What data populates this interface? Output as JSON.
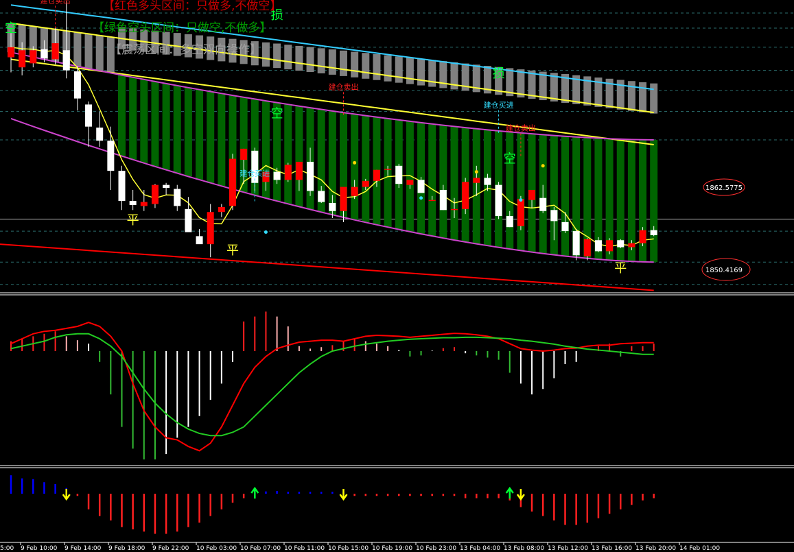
{
  "legend": {
    "red_zone": "【红色多头区间：只做多,不做空】",
    "green_zone": "【绿色空头区间：只做空,不做多】",
    "range_zone": "【震荡区间：多空双向操作】"
  },
  "price_labels": {
    "upper": "1862.5775",
    "lower": "1850.4169"
  },
  "colors": {
    "background": "#000000",
    "bull_candle": "#ff0000",
    "bear_candle": "#ffffff",
    "bear_zone_bar": "#006400",
    "range_zone_bar": "#808080",
    "envelope_line": "#cc44cc",
    "cyan_line": "#33ccff",
    "yellow_line": "#ffff33",
    "slow_red_line": "#ff0000",
    "signal_red": "#ff2020",
    "signal_cyan": "#33ddff",
    "hist_red": "#ff2020",
    "hist_pink": "#ffb0b0",
    "hist_green": "#33bb33",
    "hist_white": "#ffffff",
    "osc_red": "#ff0000",
    "osc_green": "#22cc22",
    "bar_blue": "#0000ff",
    "arrow_yellow": "#ffff00",
    "arrow_green": "#00ff33"
  },
  "chart_data": [
    {
      "type": "candlestick",
      "title": "",
      "x_labels": [
        "9 Feb 10:00",
        "9 Feb 14:00",
        "9 Feb 18:00",
        "9 Feb 22:00",
        "10 Feb 03:00",
        "10 Feb 07:00",
        "10 Feb 11:00",
        "10 Feb 15:00",
        "10 Feb 19:00",
        "10 Feb 23:00",
        "13 Feb 04:00",
        "13 Feb 08:00",
        "13 Feb 12:00",
        "13 Feb 16:00",
        "13 Feb 20:00",
        "14 Feb 01:00"
      ],
      "x_label_partial_left": "5:00",
      "y_range": [
        1847.5,
        1876.5
      ],
      "candles": [
        {
          "o": 1870.8,
          "h": 1873.2,
          "l": 1869.3,
          "c": 1871.8
        },
        {
          "o": 1869.8,
          "h": 1872.3,
          "l": 1869.0,
          "c": 1871.5
        },
        {
          "o": 1870.2,
          "h": 1871.9,
          "l": 1869.8,
          "c": 1871.5
        },
        {
          "o": 1871.6,
          "h": 1872.5,
          "l": 1870.3,
          "c": 1870.7
        },
        {
          "o": 1870.6,
          "h": 1873.7,
          "l": 1870.1,
          "c": 1872.2
        },
        {
          "o": 1871.5,
          "h": 1876.4,
          "l": 1868.7,
          "c": 1869.5
        },
        {
          "o": 1869.4,
          "h": 1869.9,
          "l": 1865.5,
          "c": 1866.7
        },
        {
          "o": 1866.1,
          "h": 1866.4,
          "l": 1861.9,
          "c": 1863.9
        },
        {
          "o": 1863.8,
          "h": 1865.4,
          "l": 1861.9,
          "c": 1862.5
        },
        {
          "o": 1862.5,
          "h": 1863.9,
          "l": 1857.6,
          "c": 1859.5
        },
        {
          "o": 1859.5,
          "h": 1860.0,
          "l": 1855.6,
          "c": 1856.5
        },
        {
          "o": 1856.5,
          "h": 1857.6,
          "l": 1855.6,
          "c": 1856.1
        },
        {
          "o": 1856.0,
          "h": 1857.6,
          "l": 1855.5,
          "c": 1856.4
        },
        {
          "o": 1856.2,
          "h": 1858.2,
          "l": 1855.8,
          "c": 1858.1
        },
        {
          "o": 1858.1,
          "h": 1858.3,
          "l": 1857.1,
          "c": 1857.8
        },
        {
          "o": 1857.7,
          "h": 1858.1,
          "l": 1855.5,
          "c": 1856.0
        },
        {
          "o": 1855.7,
          "h": 1856.9,
          "l": 1853.7,
          "c": 1853.4
        },
        {
          "o": 1853.0,
          "h": 1853.7,
          "l": 1852.8,
          "c": 1852.2
        },
        {
          "o": 1852.2,
          "h": 1856.2,
          "l": 1850.9,
          "c": 1855.4
        },
        {
          "o": 1855.4,
          "h": 1856.2,
          "l": 1854.9,
          "c": 1855.9
        },
        {
          "o": 1856.0,
          "h": 1861.2,
          "l": 1855.6,
          "c": 1860.7
        },
        {
          "o": 1860.6,
          "h": 1861.7,
          "l": 1858.2,
          "c": 1861.7
        },
        {
          "o": 1861.5,
          "h": 1861.8,
          "l": 1857.5,
          "c": 1858.3
        },
        {
          "o": 1858.4,
          "h": 1859.0,
          "l": 1857.5,
          "c": 1859.4
        },
        {
          "o": 1859.4,
          "h": 1859.8,
          "l": 1858.2,
          "c": 1858.6
        },
        {
          "o": 1858.6,
          "h": 1860.3,
          "l": 1858.4,
          "c": 1860.1
        },
        {
          "o": 1858.6,
          "h": 1860.2,
          "l": 1857.5,
          "c": 1860.4
        },
        {
          "o": 1860.4,
          "h": 1861.8,
          "l": 1857.0,
          "c": 1857.5
        },
        {
          "o": 1857.5,
          "h": 1858.0,
          "l": 1856.3,
          "c": 1856.4
        },
        {
          "o": 1856.3,
          "h": 1857.1,
          "l": 1854.8,
          "c": 1855.5
        },
        {
          "o": 1855.5,
          "h": 1856.6,
          "l": 1854.4,
          "c": 1857.9
        },
        {
          "o": 1857.0,
          "h": 1858.6,
          "l": 1856.7,
          "c": 1857.9
        },
        {
          "o": 1857.9,
          "h": 1858.7,
          "l": 1857.6,
          "c": 1858.5
        },
        {
          "o": 1858.5,
          "h": 1859.6,
          "l": 1857.9,
          "c": 1859.6
        },
        {
          "o": 1859.6,
          "h": 1860.0,
          "l": 1859.0,
          "c": 1859.7
        },
        {
          "o": 1860.0,
          "h": 1860.2,
          "l": 1857.8,
          "c": 1858.2
        },
        {
          "o": 1858.1,
          "h": 1858.3,
          "l": 1857.7,
          "c": 1858.6
        },
        {
          "o": 1858.6,
          "h": 1858.9,
          "l": 1857.4,
          "c": 1857.3
        },
        {
          "o": 1856.6,
          "h": 1857.0,
          "l": 1856.6,
          "c": 1856.6
        },
        {
          "o": 1857.6,
          "h": 1858.1,
          "l": 1855.6,
          "c": 1855.6
        },
        {
          "o": 1855.6,
          "h": 1856.8,
          "l": 1854.8,
          "c": 1855.7
        },
        {
          "o": 1855.7,
          "h": 1858.8,
          "l": 1855.2,
          "c": 1858.4
        },
        {
          "o": 1858.3,
          "h": 1860.0,
          "l": 1857.0,
          "c": 1858.8
        },
        {
          "o": 1858.8,
          "h": 1859.2,
          "l": 1857.5,
          "c": 1858.1
        },
        {
          "o": 1858.1,
          "h": 1858.4,
          "l": 1854.7,
          "c": 1855.0
        },
        {
          "o": 1855.0,
          "h": 1855.5,
          "l": 1853.9,
          "c": 1853.9
        },
        {
          "o": 1854.0,
          "h": 1857.0,
          "l": 1853.6,
          "c": 1856.7
        },
        {
          "o": 1856.6,
          "h": 1857.0,
          "l": 1855.8,
          "c": 1857.6
        },
        {
          "o": 1856.8,
          "h": 1858.1,
          "l": 1855.3,
          "c": 1855.5
        },
        {
          "o": 1855.6,
          "h": 1855.9,
          "l": 1852.6,
          "c": 1854.5
        },
        {
          "o": 1854.4,
          "h": 1855.4,
          "l": 1853.3,
          "c": 1853.5
        },
        {
          "o": 1853.5,
          "h": 1853.7,
          "l": 1850.6,
          "c": 1851.1
        },
        {
          "o": 1851.0,
          "h": 1852.8,
          "l": 1850.6,
          "c": 1852.7
        },
        {
          "o": 1852.6,
          "h": 1852.9,
          "l": 1851.4,
          "c": 1851.5
        },
        {
          "o": 1851.5,
          "h": 1852.8,
          "l": 1851.2,
          "c": 1852.6
        },
        {
          "o": 1852.6,
          "h": 1852.7,
          "l": 1851.8,
          "c": 1851.9
        },
        {
          "o": 1851.9,
          "h": 1852.6,
          "l": 1851.6,
          "c": 1852.3
        },
        {
          "o": 1852.3,
          "h": 1853.9,
          "l": 1852.0,
          "c": 1853.6
        },
        {
          "o": 1853.6,
          "h": 1854.0,
          "l": 1853.0,
          "c": 1853.1
        }
      ],
      "zones": [
        "range",
        "range",
        "range",
        "range",
        "range",
        "range",
        "range",
        "range",
        "range",
        "range",
        "bear",
        "bear",
        "bear",
        "bear",
        "bear",
        "bear",
        "bear",
        "bear",
        "bear",
        "bear",
        "bear",
        "bear",
        "bear",
        "bear",
        "bear",
        "bear",
        "bear",
        "bear",
        "bear",
        "bear",
        "bear",
        "bear",
        "bear",
        "bear",
        "bear",
        "bear",
        "bear",
        "bear",
        "bear",
        "bear",
        "bear",
        "bear",
        "bear",
        "bear",
        "bear",
        "bear",
        "bear",
        "bear",
        "bear",
        "bear",
        "bear",
        "bear",
        "bear",
        "bear",
        "bear",
        "bear",
        "bear",
        "bear",
        "bear"
      ],
      "range_band_extra": {
        "start_index": 10,
        "end_index": 58,
        "top_start": 1873.8,
        "top_end": 1868.2,
        "bottom_start": 1871.6,
        "bottom_end": 1865.2
      },
      "lines": {
        "upper_envelope": {
          "start": 1871.3,
          "end": 1862.5775,
          "shape": "concave"
        },
        "lower_envelope": {
          "start": 1864.7,
          "end": 1850.4169,
          "shape": "concave"
        },
        "cyan_slow": {
          "start": 1876.0,
          "end": 1867.6
        },
        "yellow_upper": {
          "start": 1874.2,
          "end": 1865.3
        },
        "yellow_lower": {
          "start": 1870.6,
          "end": 1862.1
        },
        "red_slow": {
          "start": 1852.2,
          "end": 1847.6
        }
      },
      "horizontal_levels": [
        1875.2,
        1873.7,
        1871.8,
        1869.5,
        1867.5,
        1865.4,
        1862.5775,
        1854.7,
        1853.5,
        1850.4169,
        1848.2
      ],
      "signals": [
        {
          "index": 0,
          "kind": "空",
          "color": "#00ff33",
          "price": 1873.3
        },
        {
          "index": 4,
          "kind": "建仓卖出",
          "color": "#ff2020",
          "price": 1876.2
        },
        {
          "index": 11,
          "kind": "平",
          "color": "#ffff33",
          "price": 1854.2
        },
        {
          "index": 20,
          "kind": "平",
          "color": "#ffff33",
          "price": 1851.2
        },
        {
          "index": 22,
          "kind": "建仓买进",
          "color": "#33ddff",
          "price": 1859.0
        },
        {
          "index": 24,
          "kind": "空",
          "color": "#00ff33",
          "price": 1864.8
        },
        {
          "index": 24,
          "kind": "损",
          "color": "#00ff33",
          "price": 1874.6
        },
        {
          "index": 30,
          "kind": "建仓卖出",
          "color": "#ff2020",
          "price": 1867.6
        },
        {
          "index": 44,
          "kind": "损",
          "color": "#00ff33",
          "price": 1868.8
        },
        {
          "index": 44,
          "kind": "建仓买进",
          "color": "#33ddff",
          "price": 1865.8
        },
        {
          "index": 46,
          "kind": "建仓卖出",
          "color": "#ff2020",
          "price": 1863.5
        },
        {
          "index": 45,
          "kind": "空",
          "color": "#00ff33",
          "price": 1860.3
        },
        {
          "index": 55,
          "kind": "平",
          "color": "#ffff33",
          "price": 1849.4
        }
      ],
      "dots": [
        {
          "index": 23,
          "color": "#33ddff",
          "price": 1853.4
        },
        {
          "index": 31,
          "color": "#ffd700",
          "price": 1860.3
        },
        {
          "index": 37,
          "color": "#33ddff",
          "price": 1856.8
        },
        {
          "index": 42,
          "color": "#ffd700",
          "price": 1859.4
        },
        {
          "index": 46,
          "color": "#33ddff",
          "price": 1856.6
        },
        {
          "index": 48,
          "color": "#ffd700",
          "price": 1860.0
        }
      ]
    },
    {
      "type": "histogram_with_lines",
      "title": "",
      "y_range": [
        -1.0,
        1.0
      ],
      "hist": [
        0.2,
        0.25,
        0.3,
        0.35,
        0.4,
        0.3,
        0.22,
        0.15,
        -0.1,
        -0.4,
        -0.7,
        -0.9,
        -1.0,
        -1.0,
        -0.95,
        -0.8,
        -0.7,
        -0.6,
        -0.45,
        -0.3,
        -0.1,
        0.6,
        0.7,
        0.8,
        0.7,
        0.5,
        0.1,
        0.05,
        0.08,
        0.12,
        0.2,
        0.25,
        0.2,
        0.15,
        0.1,
        0.02,
        -0.05,
        -0.04,
        0.01,
        0.06,
        0.08,
        -0.02,
        -0.04,
        -0.06,
        -0.08,
        -0.2,
        -0.3,
        -0.4,
        -0.35,
        -0.25,
        -0.12,
        -0.1,
        0.0,
        0.1,
        0.15,
        -0.05,
        0.1,
        0.1,
        0.15
      ],
      "hist_colors": [
        "red",
        "red",
        "red",
        "red",
        "red",
        "pink",
        "pink",
        "white",
        "green",
        "green",
        "green",
        "green",
        "green",
        "green",
        "white",
        "white",
        "white",
        "white",
        "white",
        "white",
        "white",
        "red",
        "red",
        "red",
        "pink",
        "pink",
        "pink",
        "pink",
        "pink",
        "red",
        "red",
        "red",
        "pink",
        "pink",
        "pink",
        "white",
        "green",
        "green",
        "white",
        "red",
        "red",
        "white",
        "green",
        "green",
        "green",
        "green",
        "white",
        "white",
        "white",
        "white",
        "white",
        "white",
        "red",
        "red",
        "red",
        "green",
        "red",
        "red",
        "red"
      ],
      "osc_red": [
        0.15,
        0.25,
        0.35,
        0.4,
        0.42,
        0.46,
        0.5,
        0.58,
        0.5,
        0.3,
        0.0,
        -0.3,
        -0.55,
        -0.7,
        -0.8,
        -0.82,
        -0.88,
        -0.92,
        -0.85,
        -0.7,
        -0.5,
        -0.3,
        -0.15,
        -0.05,
        0.05,
        0.12,
        0.18,
        0.2,
        0.22,
        0.22,
        0.2,
        0.25,
        0.3,
        0.32,
        0.31,
        0.3,
        0.28,
        0.3,
        0.32,
        0.34,
        0.36,
        0.35,
        0.33,
        0.3,
        0.25,
        0.15,
        0.05,
        0.02,
        0.0,
        0.02,
        0.05,
        0.06,
        0.1,
        0.12,
        0.12,
        0.15,
        0.16,
        0.17,
        0.17
      ],
      "osc_green": [
        0.05,
        0.1,
        0.15,
        0.2,
        0.28,
        0.33,
        0.35,
        0.35,
        0.25,
        0.1,
        -0.05,
        -0.2,
        -0.35,
        -0.48,
        -0.58,
        -0.66,
        -0.72,
        -0.76,
        -0.78,
        -0.78,
        -0.75,
        -0.7,
        -0.6,
        -0.5,
        -0.4,
        -0.3,
        -0.2,
        -0.12,
        -0.05,
        0.0,
        0.05,
        0.1,
        0.14,
        0.17,
        0.2,
        0.22,
        0.24,
        0.25,
        0.26,
        0.27,
        0.27,
        0.28,
        0.28,
        0.27,
        0.26,
        0.25,
        0.22,
        0.2,
        0.17,
        0.14,
        0.1,
        0.07,
        0.04,
        0.02,
        0.0,
        -0.01,
        -0.02,
        -0.03,
        -0.03
      ]
    },
    {
      "type": "histogram_with_arrows",
      "title": "",
      "y_range": [
        -1.0,
        0.5
      ],
      "bars": [
        0.48,
        0.4,
        0.38,
        0.3,
        0.25,
        0.15,
        -0.05,
        -0.35,
        -0.5,
        -0.6,
        -0.75,
        -0.8,
        -0.85,
        -0.9,
        -0.9,
        -0.85,
        -0.75,
        -0.65,
        -0.5,
        -0.35,
        -0.2,
        -0.1,
        0.05,
        0.06,
        0.07,
        0.05,
        0.05,
        0.05,
        0.05,
        0.05,
        0.05,
        -0.05,
        -0.05,
        -0.05,
        -0.05,
        -0.05,
        -0.05,
        -0.05,
        -0.05,
        -0.05,
        -0.05,
        -0.1,
        -0.1,
        -0.1,
        -0.1,
        -0.15,
        -0.3,
        -0.4,
        -0.5,
        -0.6,
        -0.7,
        -0.7,
        -0.65,
        -0.55,
        -0.45,
        -0.35,
        -0.25,
        -0.15,
        -0.1
      ],
      "bar_colors": [
        "blue",
        "blue",
        "blue",
        "blue",
        "blue",
        "blue",
        "red",
        "red",
        "red",
        "red",
        "red",
        "red",
        "red",
        "red",
        "red",
        "red",
        "red",
        "red",
        "red",
        "red",
        "red",
        "red",
        "blue",
        "blue",
        "blue",
        "blue",
        "blue",
        "blue",
        "blue",
        "blue",
        "blue",
        "red",
        "red",
        "red",
        "red",
        "red",
        "red",
        "red",
        "red",
        "red",
        "red",
        "red",
        "red",
        "red",
        "red",
        "red",
        "red",
        "red",
        "red",
        "red",
        "red",
        "red",
        "red",
        "red",
        "red",
        "red",
        "red",
        "red",
        "red"
      ],
      "arrows": [
        {
          "index": 5,
          "dir": "down",
          "color": "yellow"
        },
        {
          "index": 22,
          "dir": "up",
          "color": "green"
        },
        {
          "index": 30,
          "dir": "down",
          "color": "yellow"
        },
        {
          "index": 45,
          "dir": "up",
          "color": "green"
        },
        {
          "index": 46,
          "dir": "down",
          "color": "yellow"
        }
      ]
    }
  ]
}
